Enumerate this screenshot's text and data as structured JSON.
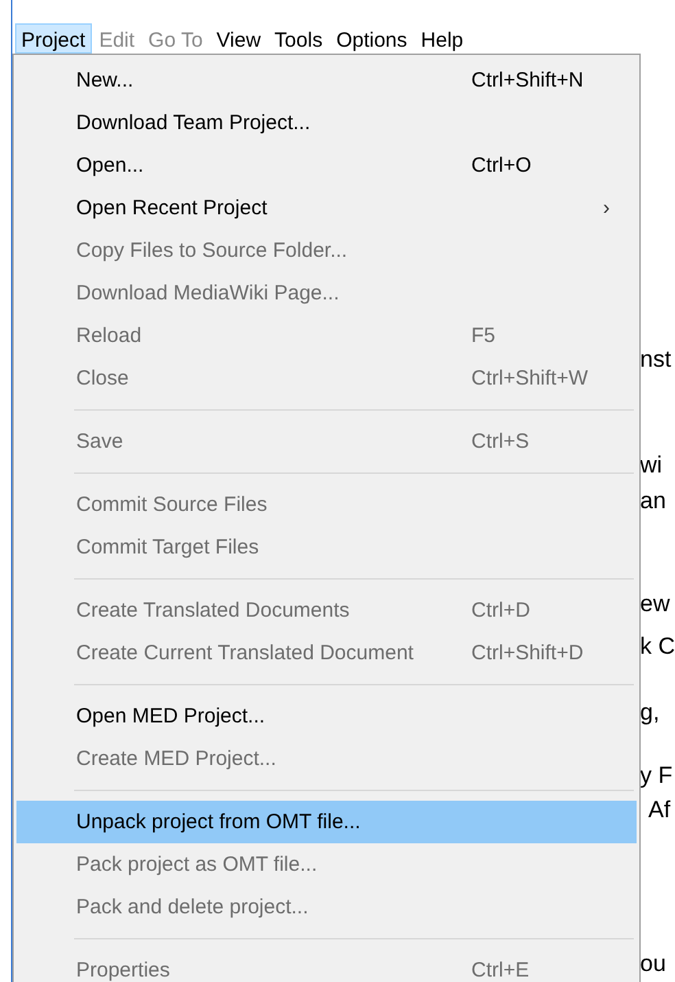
{
  "menu_bar": [
    {
      "label": "Project",
      "selected": true,
      "disabled": false
    },
    {
      "label": "Edit",
      "selected": false,
      "disabled": true
    },
    {
      "label": "Go To",
      "selected": false,
      "disabled": true
    },
    {
      "label": "View",
      "selected": false,
      "disabled": false
    },
    {
      "label": "Tools",
      "selected": false,
      "disabled": false
    },
    {
      "label": "Options",
      "selected": false,
      "disabled": false
    },
    {
      "label": "Help",
      "selected": false,
      "disabled": false
    }
  ],
  "menu": [
    {
      "kind": "item",
      "label": "New...",
      "shortcut": "Ctrl+Shift+N",
      "disabled": false,
      "selected": false,
      "submenu": false
    },
    {
      "kind": "item",
      "label": "Download Team Project...",
      "disabled": false,
      "selected": false,
      "submenu": false
    },
    {
      "kind": "item",
      "label": "Open...",
      "shortcut": "Ctrl+O",
      "disabled": false,
      "selected": false,
      "submenu": false
    },
    {
      "kind": "item",
      "label": "Open Recent Project",
      "disabled": false,
      "selected": false,
      "submenu": true
    },
    {
      "kind": "item",
      "label": "Copy Files to Source Folder...",
      "disabled": true,
      "selected": false,
      "submenu": false
    },
    {
      "kind": "item",
      "label": "Download MediaWiki Page...",
      "disabled": true,
      "selected": false,
      "submenu": false
    },
    {
      "kind": "item",
      "label": "Reload",
      "shortcut": "F5",
      "disabled": true,
      "selected": false,
      "submenu": false
    },
    {
      "kind": "item",
      "label": "Close",
      "shortcut": "Ctrl+Shift+W",
      "disabled": true,
      "selected": false,
      "submenu": false
    },
    {
      "kind": "separator"
    },
    {
      "kind": "item",
      "label": "Save",
      "shortcut": "Ctrl+S",
      "disabled": true,
      "selected": false,
      "submenu": false
    },
    {
      "kind": "separator"
    },
    {
      "kind": "item",
      "label": "Commit Source Files",
      "disabled": true,
      "selected": false,
      "submenu": false
    },
    {
      "kind": "item",
      "label": "Commit Target Files",
      "disabled": true,
      "selected": false,
      "submenu": false
    },
    {
      "kind": "separator"
    },
    {
      "kind": "item",
      "label": "Create Translated Documents",
      "shortcut": "Ctrl+D",
      "disabled": true,
      "selected": false,
      "submenu": false
    },
    {
      "kind": "item",
      "label": "Create Current Translated Document",
      "shortcut": "Ctrl+Shift+D",
      "disabled": true,
      "selected": false,
      "submenu": false
    },
    {
      "kind": "separator"
    },
    {
      "kind": "item",
      "label": "Open MED Project...",
      "disabled": false,
      "selected": false,
      "submenu": false
    },
    {
      "kind": "item",
      "label": "Create MED Project...",
      "disabled": true,
      "selected": false,
      "submenu": false
    },
    {
      "kind": "separator"
    },
    {
      "kind": "item",
      "label": "Unpack project from OMT file...",
      "disabled": false,
      "selected": true,
      "submenu": false
    },
    {
      "kind": "item",
      "label": "Pack project as OMT file...",
      "disabled": true,
      "selected": false,
      "submenu": false
    },
    {
      "kind": "item",
      "label": "Pack and delete project...",
      "disabled": true,
      "selected": false,
      "submenu": false
    },
    {
      "kind": "separator"
    },
    {
      "kind": "item",
      "label": "Properties",
      "shortcut": "Ctrl+E",
      "disabled": true,
      "selected": false,
      "submenu": false
    }
  ],
  "submenu_arrow": "›",
  "background_text": [
    "nst",
    "wi",
    "an",
    "ew",
    "k C",
    "g,",
    "y F",
    "Af",
    "ou"
  ]
}
